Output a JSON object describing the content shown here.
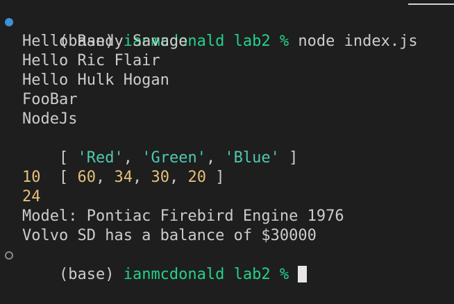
{
  "colors": {
    "background": "#1e1e1e",
    "text": "#cccccc",
    "prompt_user": "#23d18b",
    "string": "#4ec9b0",
    "number": "#e5c07b",
    "status_dot_success": "#3f8fd8",
    "status_dot_pending": "#8a8a8a"
  },
  "prompt1": {
    "env": "(base) ",
    "user": "ianmcdonald",
    "dir": " lab2",
    "symbol": " % ",
    "command": "node index.js"
  },
  "output": {
    "line1": "Hello Randy Savage",
    "line2": "Hello Ric Flair",
    "line3": "Hello Hulk Hogan",
    "line4": "FooBar",
    "line5": "NodeJs",
    "array_strings": {
      "open": "[ ",
      "items": [
        "'Red'",
        "'Green'",
        "'Blue'"
      ],
      "sep": ", ",
      "close": " ]"
    },
    "array_numbers": {
      "open": "[ ",
      "items": [
        "60",
        "34",
        "30",
        "20"
      ],
      "sep": ", ",
      "close": " ]"
    },
    "num1": "10",
    "num2": "24",
    "line_model": "Model: Pontiac Firebird Engine 1976",
    "line_balance": "Volvo SD has a balance of $30000"
  },
  "prompt2": {
    "env": "(base) ",
    "user": "ianmcdonald",
    "dir": " lab2",
    "symbol": " % "
  }
}
